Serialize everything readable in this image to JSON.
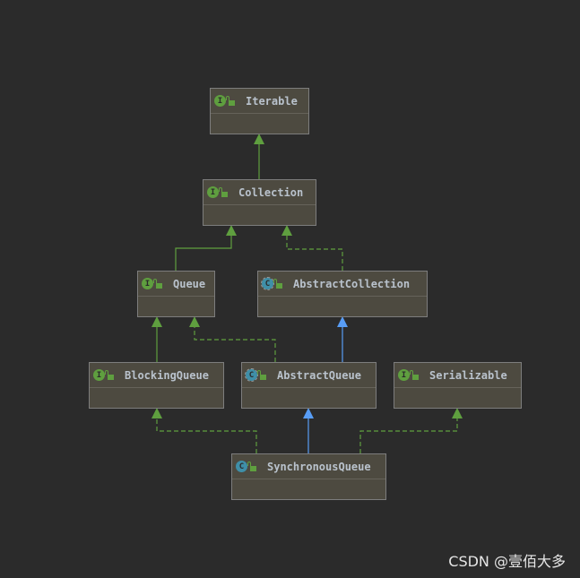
{
  "nodes": [
    {
      "name": "Iterable",
      "kind": "interface",
      "badge": "I"
    },
    {
      "name": "Collection",
      "kind": "interface",
      "badge": "I"
    },
    {
      "name": "Queue",
      "kind": "interface",
      "badge": "I"
    },
    {
      "name": "AbstractCollection",
      "kind": "abstract-class",
      "badge": "C"
    },
    {
      "name": "BlockingQueue",
      "kind": "interface",
      "badge": "I"
    },
    {
      "name": "AbstractQueue",
      "kind": "abstract-class",
      "badge": "C"
    },
    {
      "name": "Serializable",
      "kind": "interface",
      "badge": "I"
    },
    {
      "name": "SynchronousQueue",
      "kind": "class",
      "badge": "C"
    }
  ],
  "edges": [
    {
      "from": "Collection",
      "to": "Iterable",
      "type": "extends-interface"
    },
    {
      "from": "Queue",
      "to": "Collection",
      "type": "extends-interface"
    },
    {
      "from": "AbstractCollection",
      "to": "Collection",
      "type": "implements"
    },
    {
      "from": "BlockingQueue",
      "to": "Queue",
      "type": "extends-interface"
    },
    {
      "from": "AbstractQueue",
      "to": "Queue",
      "type": "implements"
    },
    {
      "from": "AbstractQueue",
      "to": "AbstractCollection",
      "type": "extends"
    },
    {
      "from": "SynchronousQueue",
      "to": "BlockingQueue",
      "type": "implements"
    },
    {
      "from": "SynchronousQueue",
      "to": "AbstractQueue",
      "type": "extends"
    },
    {
      "from": "SynchronousQueue",
      "to": "Serializable",
      "type": "implements"
    }
  ],
  "colors": {
    "interface": "#5f9f3f",
    "class": "#3f8fa8",
    "extends": "#589df6",
    "implements": "#5f9f3f",
    "background": "#2b2b2b",
    "node": "#4d4a40"
  },
  "watermark": "CSDN @壹佰大多"
}
